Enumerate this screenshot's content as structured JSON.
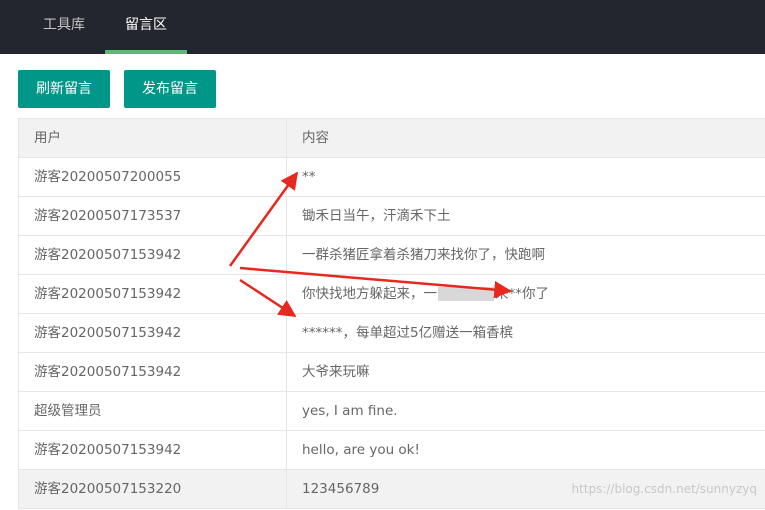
{
  "nav": {
    "tabs": [
      {
        "label": "工具库"
      },
      {
        "label": "留言区"
      }
    ]
  },
  "toolbar": {
    "refresh_label": "刷新留言",
    "post_label": "发布留言"
  },
  "table": {
    "headers": [
      "用户",
      "内容"
    ],
    "rows": [
      {
        "user": "游客20200507200055",
        "content": "**"
      },
      {
        "user": "游客20200507173537",
        "content": "锄禾日当午，汗滴禾下土"
      },
      {
        "user": "游客20200507153942",
        "content": "一群杀猪匠拿着杀猪刀来找你了，快跑啊"
      },
      {
        "user": "游客20200507153942",
        "content_prefix": "你快找地方躲起来，一",
        "content_suffix": "来**你了"
      },
      {
        "user": "游客20200507153942",
        "content": "******，每单超过5亿赠送一箱香槟"
      },
      {
        "user": "游客20200507153942",
        "content": "大爷来玩嘛"
      },
      {
        "user": "超级管理员",
        "content": "yes, I am fine."
      },
      {
        "user": "游客20200507153942",
        "content": "hello, are you ok!"
      },
      {
        "user": "游客20200507153220",
        "content": "123456789"
      }
    ]
  },
  "watermark": "https://blog.csdn.net/sunnyzyq",
  "colors": {
    "topbar": "#23262e",
    "accent": "#009688",
    "tab_active_underline": "#5fb878",
    "arrow": "#e8281e"
  }
}
